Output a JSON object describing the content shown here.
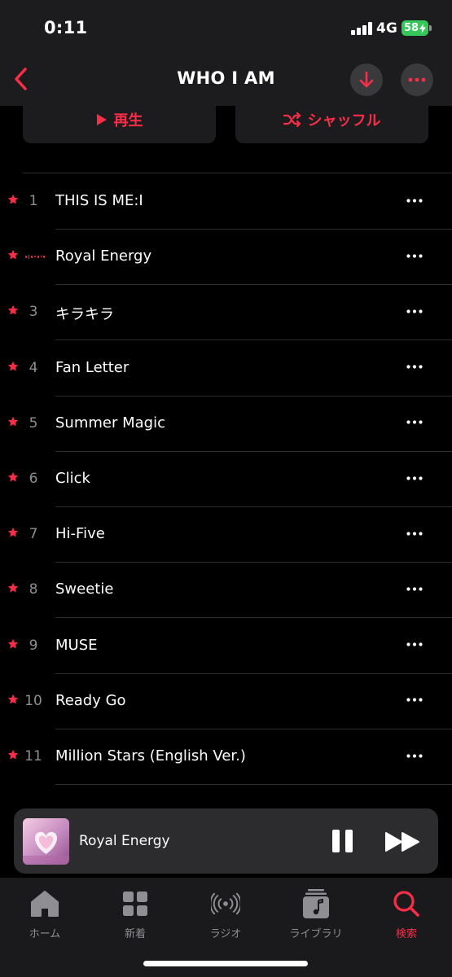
{
  "status_bar": {
    "time": "0:11",
    "network": "4G",
    "battery": "58"
  },
  "nav": {
    "title": "WHO I AM"
  },
  "actions": {
    "play_label": "再生",
    "shuffle_label": "シャッフル"
  },
  "tracks": [
    {
      "number": "1",
      "title": "THIS IS ME:I",
      "playing": false
    },
    {
      "number": "",
      "title": "Royal Energy",
      "playing": true
    },
    {
      "number": "3",
      "title": "キラキラ",
      "playing": false
    },
    {
      "number": "4",
      "title": "Fan Letter",
      "playing": false
    },
    {
      "number": "5",
      "title": "Summer Magic",
      "playing": false
    },
    {
      "number": "6",
      "title": "Click",
      "playing": false
    },
    {
      "number": "7",
      "title": "Hi-Five",
      "playing": false
    },
    {
      "number": "8",
      "title": "Sweetie",
      "playing": false
    },
    {
      "number": "9",
      "title": "MUSE",
      "playing": false
    },
    {
      "number": "10",
      "title": "Ready Go",
      "playing": false
    },
    {
      "number": "11",
      "title": "Million Stars (English Ver.)",
      "playing": false
    }
  ],
  "now_playing": {
    "title": "Royal Energy"
  },
  "tab_bar": {
    "tabs": [
      {
        "label": "ホーム",
        "icon": "home-icon",
        "active": false
      },
      {
        "label": "新着",
        "icon": "grid-icon",
        "active": false
      },
      {
        "label": "ラジオ",
        "icon": "radio-icon",
        "active": false
      },
      {
        "label": "ライブラリ",
        "icon": "library-icon",
        "active": false
      },
      {
        "label": "検索",
        "icon": "search-icon",
        "active": true
      }
    ]
  },
  "colors": {
    "accent": "#fa2d48",
    "background": "#000000",
    "secondary_text": "#8e8e93",
    "battery": "#34c759"
  }
}
